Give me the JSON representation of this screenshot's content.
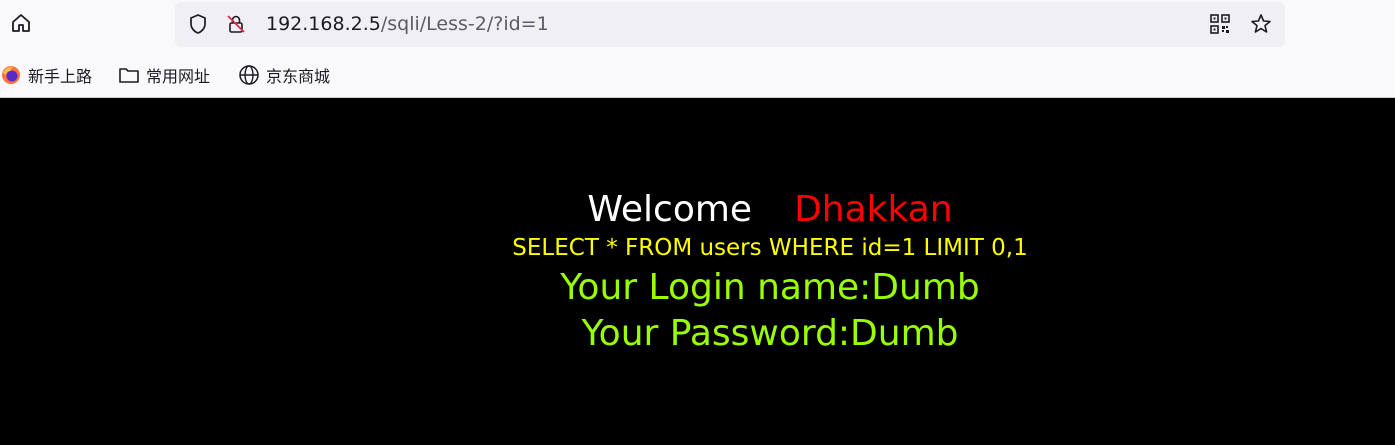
{
  "browser": {
    "url_host": "192.168.2.5",
    "url_path": "/sqli/Less-2/?id=1",
    "icons": {
      "home": "home-icon",
      "shield": "shield-icon",
      "insecure_lock": "insecure-lock-icon",
      "qr": "qr-code-icon",
      "bookmark_star": "star-icon"
    },
    "bookmarks": [
      {
        "label": "新手上路",
        "icon": "firefox-icon"
      },
      {
        "label": "常用网址",
        "icon": "folder-icon"
      },
      {
        "label": "京东商城",
        "icon": "globe-icon"
      }
    ]
  },
  "page": {
    "welcome": "Welcome",
    "username": "Dhakkan",
    "query": "SELECT * FROM users WHERE id=1 LIMIT 0,1",
    "login_name": "Your Login name:Dumb",
    "password": "Your Password:Dumb",
    "colors": {
      "background": "#000000",
      "welcome": "#ffffff",
      "username": "#ff0000",
      "query": "#ffff00",
      "result": "#99ff00"
    }
  }
}
